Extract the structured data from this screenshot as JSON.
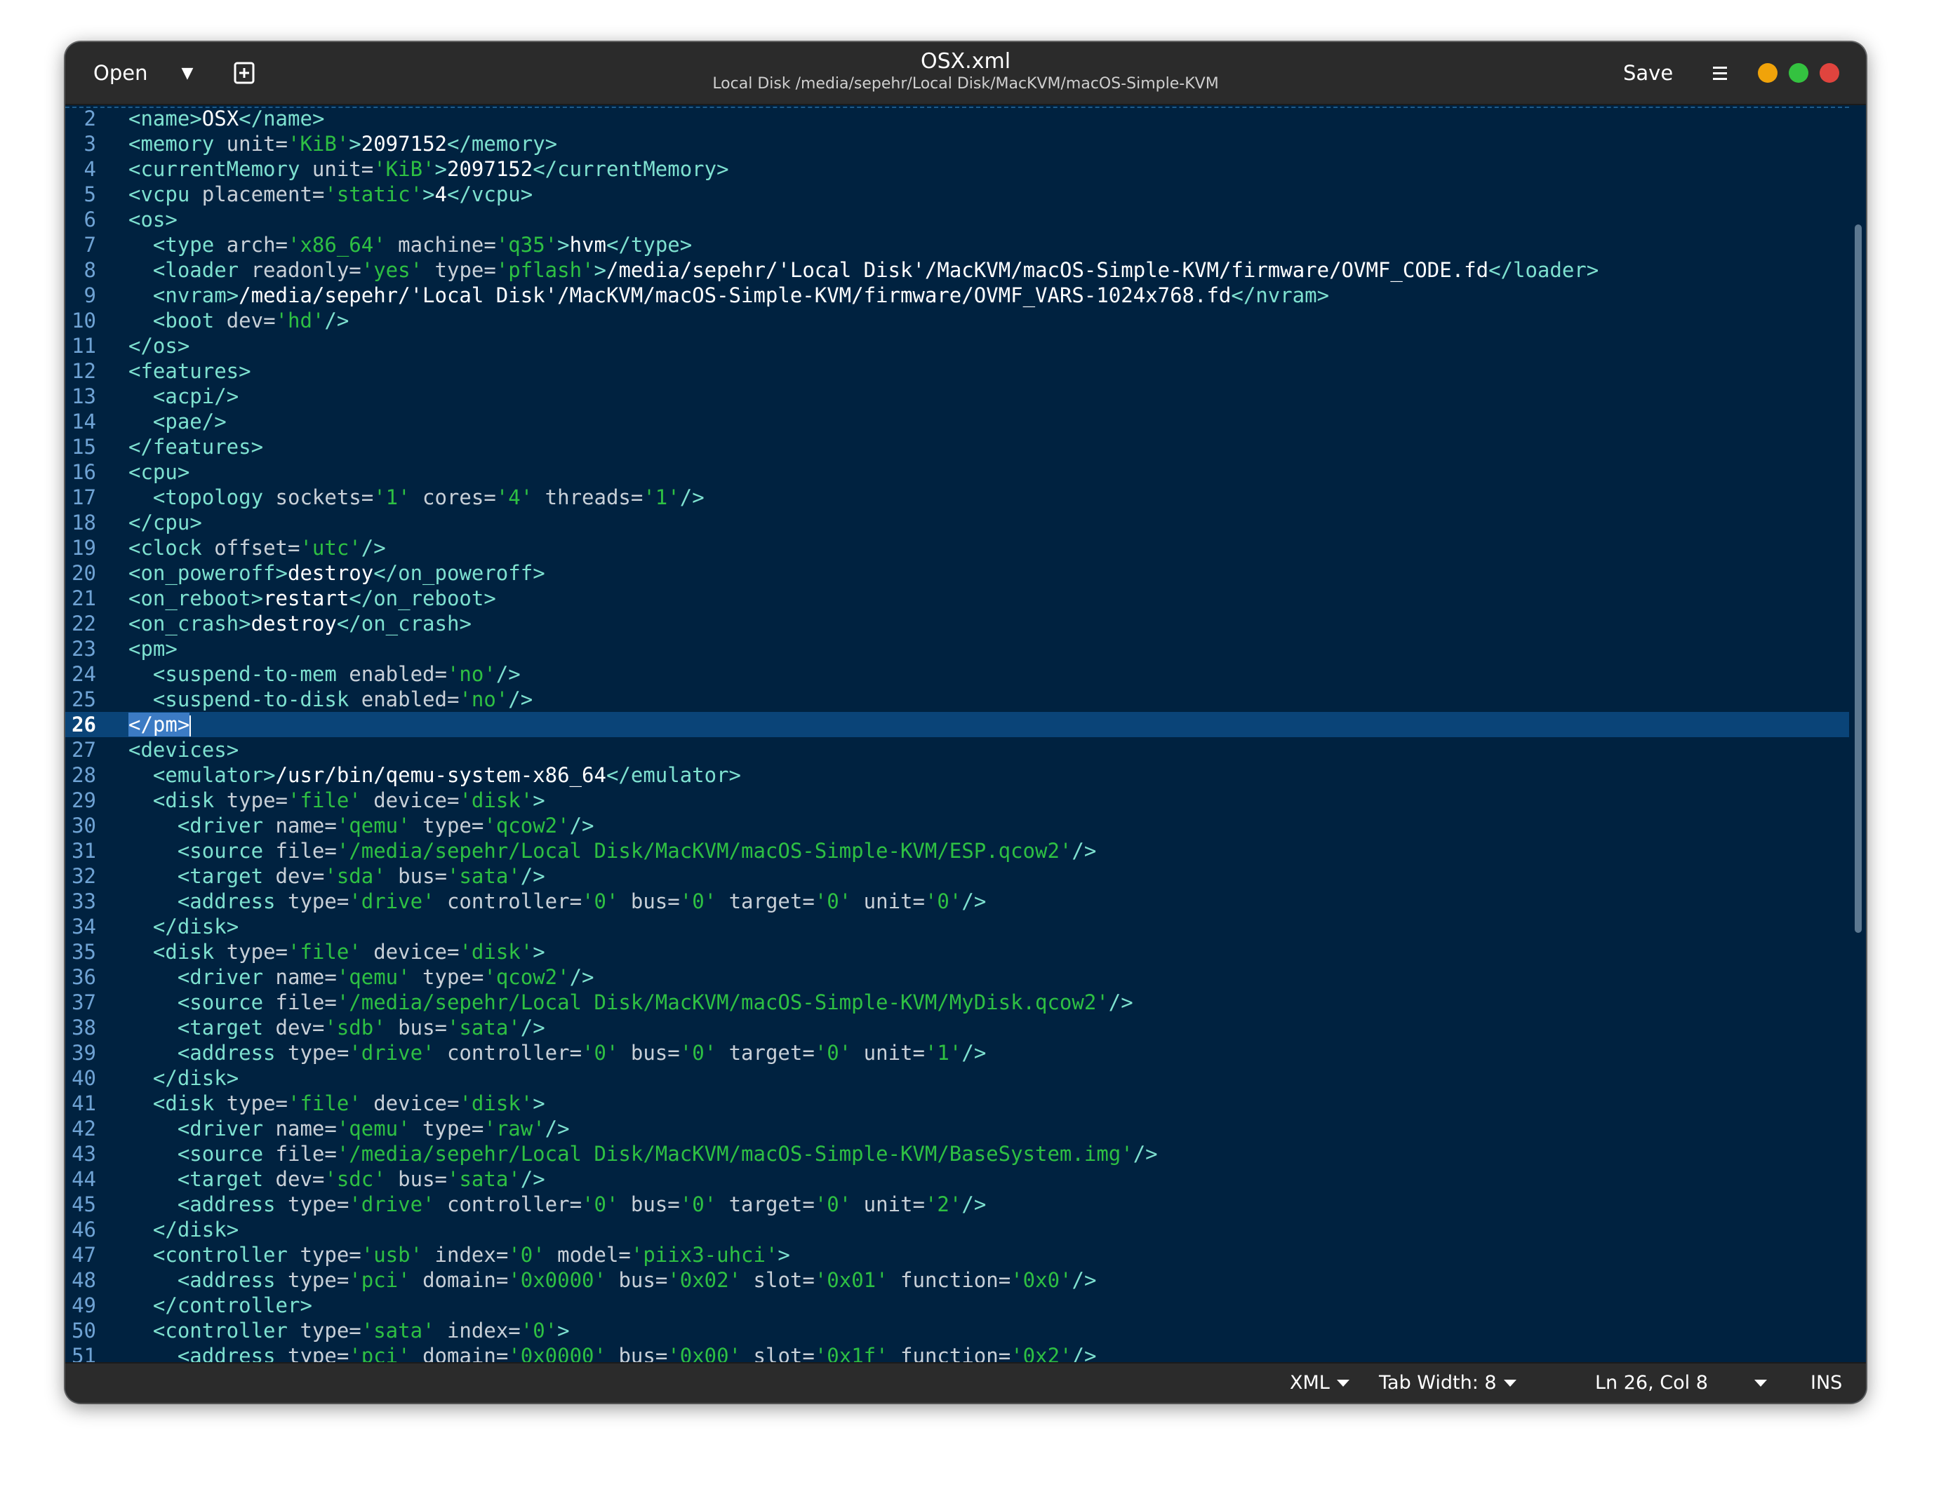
{
  "header": {
    "open_label": "Open",
    "title": "OSX.xml",
    "subtitle": "Local Disk /media/sepehr/Local Disk/MacKVM/macOS-Simple-KVM",
    "save_label": "Save",
    "icons": [
      "chevron-down-icon",
      "new-tab-icon",
      "hamburger-menu-icon"
    ],
    "window_controls": {
      "minimize": "#f0a30a",
      "maximize": "#34c240",
      "close": "#e0443e"
    }
  },
  "editor": {
    "background": "#002240",
    "current_line_number": 26,
    "lines": [
      {
        "n": "2",
        "code": "<name>OSX</name>"
      },
      {
        "n": "3",
        "code": "<memory unit='KiB'>2097152</memory>"
      },
      {
        "n": "4",
        "code": "<currentMemory unit='KiB'>2097152</currentMemory>"
      },
      {
        "n": "5",
        "code": "<vcpu placement='static'>4</vcpu>"
      },
      {
        "n": "6",
        "code": "<os>"
      },
      {
        "n": "7",
        "code": "  <type arch='x86_64' machine='q35'>hvm</type>"
      },
      {
        "n": "8",
        "code": "  <loader readonly='yes' type='pflash'>/media/sepehr/'Local Disk'/MacKVM/macOS-Simple-KVM/firmware/OVMF_CODE.fd</loader>"
      },
      {
        "n": "9",
        "code": "  <nvram>/media/sepehr/'Local Disk'/MacKVM/macOS-Simple-KVM/firmware/OVMF_VARS-1024x768.fd</nvram>"
      },
      {
        "n": "10",
        "code": "  <boot dev='hd'/>"
      },
      {
        "n": "11",
        "code": "</os>"
      },
      {
        "n": "12",
        "code": "<features>"
      },
      {
        "n": "13",
        "code": "  <acpi/>"
      },
      {
        "n": "14",
        "code": "  <pae/>"
      },
      {
        "n": "15",
        "code": "</features>"
      },
      {
        "n": "16",
        "code": "<cpu>"
      },
      {
        "n": "17",
        "code": "  <topology sockets='1' cores='4' threads='1'/>"
      },
      {
        "n": "18",
        "code": "</cpu>"
      },
      {
        "n": "19",
        "code": "<clock offset='utc'/>"
      },
      {
        "n": "20",
        "code": "<on_poweroff>destroy</on_poweroff>"
      },
      {
        "n": "21",
        "code": "<on_reboot>restart</on_reboot>"
      },
      {
        "n": "22",
        "code": "<on_crash>destroy</on_crash>"
      },
      {
        "n": "23",
        "code": "<pm>"
      },
      {
        "n": "24",
        "code": "  <suspend-to-mem enabled='no'/>"
      },
      {
        "n": "25",
        "code": "  <suspend-to-disk enabled='no'/>"
      },
      {
        "n": "26",
        "code": "</pm>"
      },
      {
        "n": "27",
        "code": "<devices>"
      },
      {
        "n": "28",
        "code": "  <emulator>/usr/bin/qemu-system-x86_64</emulator>"
      },
      {
        "n": "29",
        "code": "  <disk type='file' device='disk'>"
      },
      {
        "n": "30",
        "code": "    <driver name='qemu' type='qcow2'/>"
      },
      {
        "n": "31",
        "code": "    <source file='/media/sepehr/Local Disk/MacKVM/macOS-Simple-KVM/ESP.qcow2'/>"
      },
      {
        "n": "32",
        "code": "    <target dev='sda' bus='sata'/>"
      },
      {
        "n": "33",
        "code": "    <address type='drive' controller='0' bus='0' target='0' unit='0'/>"
      },
      {
        "n": "34",
        "code": "  </disk>"
      },
      {
        "n": "35",
        "code": "  <disk type='file' device='disk'>"
      },
      {
        "n": "36",
        "code": "    <driver name='qemu' type='qcow2'/>"
      },
      {
        "n": "37",
        "code": "    <source file='/media/sepehr/Local Disk/MacKVM/macOS-Simple-KVM/MyDisk.qcow2'/>"
      },
      {
        "n": "38",
        "code": "    <target dev='sdb' bus='sata'/>"
      },
      {
        "n": "39",
        "code": "    <address type='drive' controller='0' bus='0' target='0' unit='1'/>"
      },
      {
        "n": "40",
        "code": "  </disk>"
      },
      {
        "n": "41",
        "code": "  <disk type='file' device='disk'>"
      },
      {
        "n": "42",
        "code": "    <driver name='qemu' type='raw'/>"
      },
      {
        "n": "43",
        "code": "    <source file='/media/sepehr/Local Disk/MacKVM/macOS-Simple-KVM/BaseSystem.img'/>"
      },
      {
        "n": "44",
        "code": "    <target dev='sdc' bus='sata'/>"
      },
      {
        "n": "45",
        "code": "    <address type='drive' controller='0' bus='0' target='0' unit='2'/>"
      },
      {
        "n": "46",
        "code": "  </disk>"
      },
      {
        "n": "47",
        "code": "  <controller type='usb' index='0' model='piix3-uhci'>"
      },
      {
        "n": "48",
        "code": "    <address type='pci' domain='0x0000' bus='0x02' slot='0x01' function='0x0'/>"
      },
      {
        "n": "49",
        "code": "  </controller>"
      },
      {
        "n": "50",
        "code": "  <controller type='sata' index='0'>"
      },
      {
        "n": "51",
        "code": "    <address type='pci' domain='0x0000' bus='0x00' slot='0x1f' function='0x2'/>"
      }
    ]
  },
  "statusbar": {
    "language": "XML",
    "tab_width": "Tab Width: 8",
    "position": "Ln 26, Col 8",
    "mode": "INS"
  }
}
